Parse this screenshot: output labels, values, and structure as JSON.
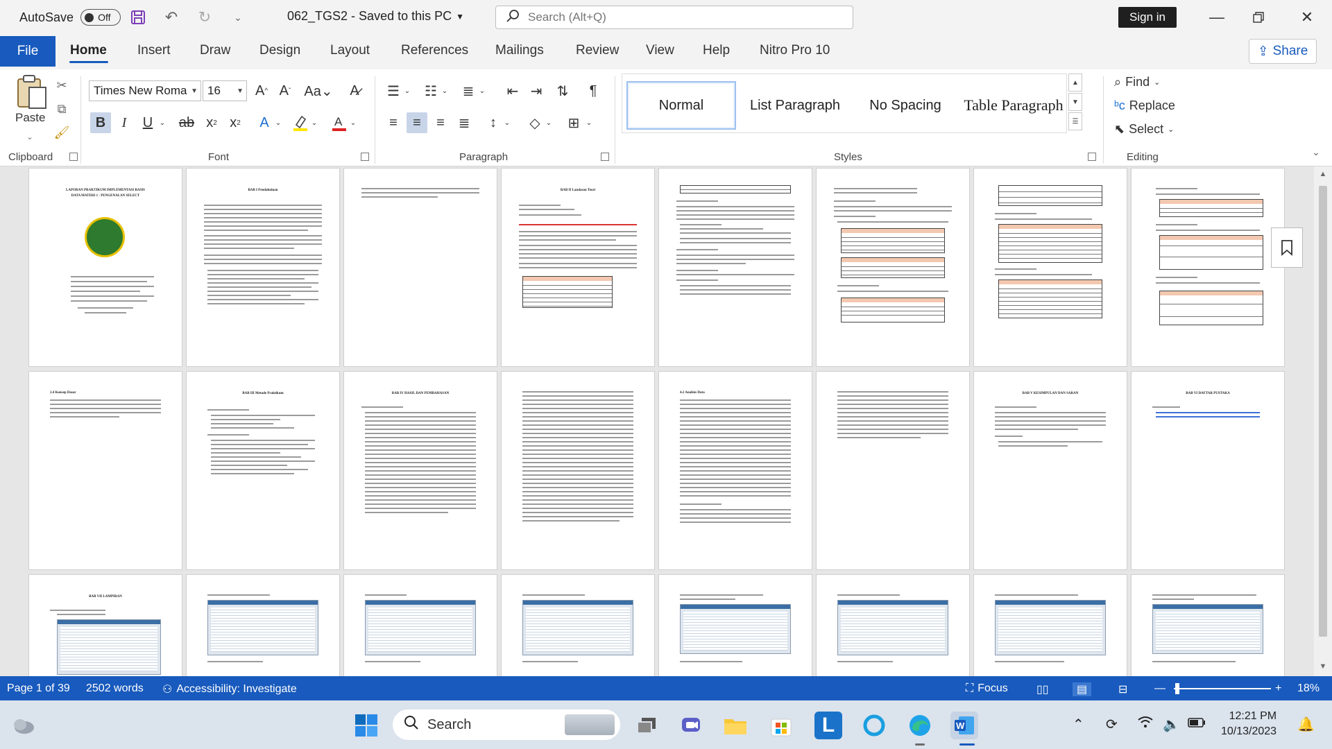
{
  "titlebar": {
    "autosave_label": "AutoSave",
    "autosave_state": "Off",
    "doc_title": "062_TGS2  -  Saved to this PC",
    "search_placeholder": "Search (Alt+Q)",
    "signin_label": "Sign in"
  },
  "tabs": {
    "file": "File",
    "items": [
      "Home",
      "Insert",
      "Draw",
      "Design",
      "Layout",
      "References",
      "Mailings",
      "Review",
      "View",
      "Help",
      "Nitro Pro 10"
    ],
    "active": "Home",
    "share_label": "Share"
  },
  "ribbon": {
    "clipboard": {
      "label": "Clipboard",
      "paste_label": "Paste"
    },
    "font": {
      "label": "Font",
      "font_name": "Times New Roma",
      "font_size": "16"
    },
    "paragraph": {
      "label": "Paragraph"
    },
    "styles": {
      "label": "Styles",
      "items": [
        "Normal",
        "List Paragraph",
        "No Spacing",
        "Table Paragraph"
      ],
      "selected": "Normal"
    },
    "editing": {
      "label": "Editing",
      "find": "Find",
      "replace": "Replace",
      "select": "Select"
    }
  },
  "document": {
    "pages_row1": [
      {
        "title": "LAPORAN PRAKTIKUM IMPLEMENTASI BASIS DATA MATERI 1 - PENGENALAN SELECT"
      },
      {
        "title": "BAB I Pendahuluan"
      },
      {
        "title": ""
      },
      {
        "title": "BAB II Landasan Teori"
      },
      {
        "title": ""
      },
      {
        "title": ""
      },
      {
        "title": ""
      },
      {
        "title": ""
      }
    ],
    "pages_row2": [
      {
        "title": "2.4 Konsep Dasar"
      },
      {
        "title": "BAB III Metode Praktikum"
      },
      {
        "title": "BAB IV HASIL DAN PEMBAHASAN"
      },
      {
        "title": ""
      },
      {
        "title": "4.2 Analisis Data"
      },
      {
        "title": ""
      },
      {
        "title": "BAB V KESIMPULAN DAN SARAN"
      },
      {
        "title": "BAB VI DAFTAR PUSTAKA"
      }
    ],
    "pages_row3": [
      {
        "title": "BAB VII LAMPIRAN"
      },
      {
        "title": ""
      },
      {
        "title": ""
      },
      {
        "title": ""
      },
      {
        "title": ""
      },
      {
        "title": ""
      },
      {
        "title": ""
      },
      {
        "title": ""
      }
    ]
  },
  "statusbar": {
    "page": "Page 1 of 39",
    "words": "2502 words",
    "accessibility": "Accessibility: Investigate",
    "focus": "Focus",
    "zoom": "18%",
    "zoom_fraction": 0.18
  },
  "taskbar": {
    "search_label": "Search",
    "time": "12:21 PM",
    "date": "10/13/2023"
  },
  "colors": {
    "accent": "#185abd",
    "titlebar_bg": "#f3f3f3",
    "taskbar_bg": "#dbe3ed"
  }
}
